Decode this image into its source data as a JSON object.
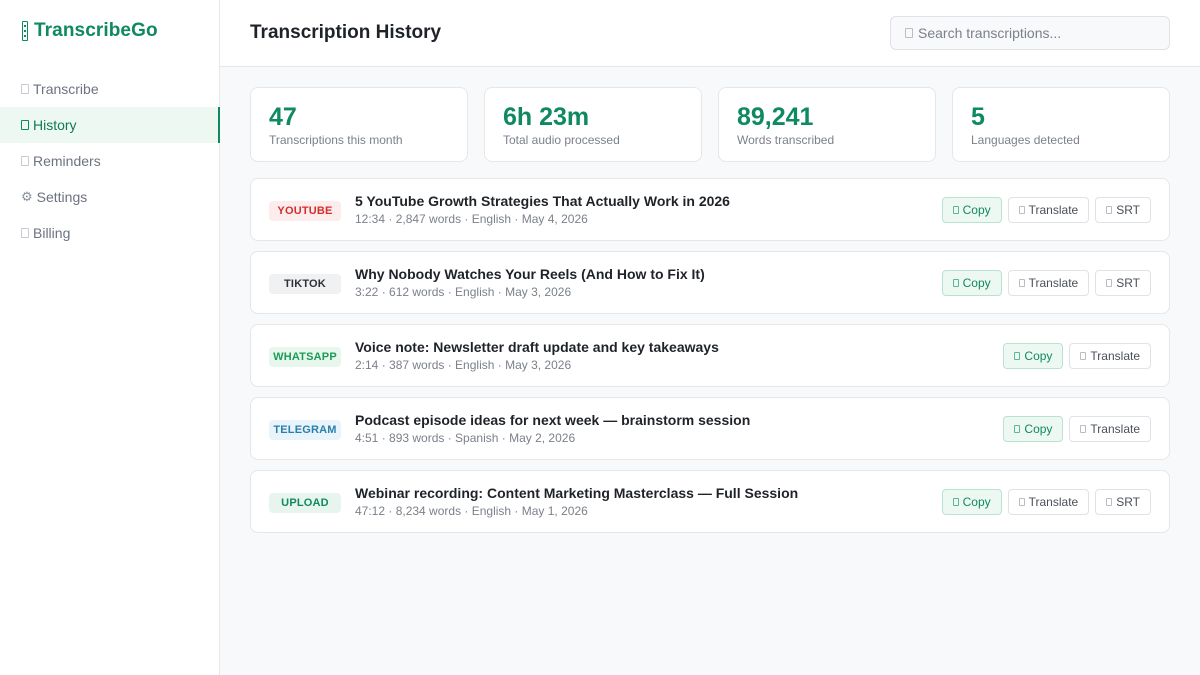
{
  "brand": {
    "name": "TranscribeGo",
    "color": "#0f8a5f"
  },
  "sidebar": {
    "items": [
      {
        "label": "Transcribe",
        "icon": "document-icon",
        "active": false
      },
      {
        "label": "History",
        "icon": "history-icon",
        "active": true
      },
      {
        "label": "Reminders",
        "icon": "reminder-icon",
        "active": false
      },
      {
        "label": "Settings",
        "icon": "gear-icon",
        "glyph": "⚙",
        "active": false
      },
      {
        "label": "Billing",
        "icon": "billing-icon",
        "active": false
      }
    ]
  },
  "header": {
    "title": "Transcription History",
    "search_placeholder": "Search transcriptions..."
  },
  "stats": [
    {
      "value": "47",
      "label": "Transcriptions this month"
    },
    {
      "value": "6h 23m",
      "label": "Total audio processed"
    },
    {
      "value": "89,241",
      "label": "Words transcribed"
    },
    {
      "value": "5",
      "label": "Languages detected"
    }
  ],
  "actions": {
    "copy": "Copy",
    "translate": "Translate",
    "srt": "SRT"
  },
  "transcriptions": [
    {
      "source": "YOUTUBE",
      "badge_class": "b-youtube",
      "title": "5 YouTube Growth Strategies That Actually Work in 2026",
      "meta": "12:34 · 2,847 words · English · May 4, 2026",
      "has_srt": true
    },
    {
      "source": "TIKTOK",
      "badge_class": "b-tiktok",
      "title": "Why Nobody Watches Your Reels (And How to Fix It)",
      "meta": "3:22 · 612 words · English · May 3, 2026",
      "has_srt": true
    },
    {
      "source": "WHATSAPP",
      "badge_class": "b-whatsapp",
      "title": "Voice note: Newsletter draft update and key takeaways",
      "meta": "2:14 · 387 words · English · May 3, 2026",
      "has_srt": false
    },
    {
      "source": "TELEGRAM",
      "badge_class": "b-telegram",
      "title": "Podcast episode ideas for next week — brainstorm session",
      "meta": "4:51 · 893 words · Spanish · May 2, 2026",
      "has_srt": false
    },
    {
      "source": "UPLOAD",
      "badge_class": "b-upload",
      "title": "Webinar recording: Content Marketing Masterclass — Full Session",
      "meta": "47:12 · 8,234 words · English · May 1, 2026",
      "has_srt": true
    }
  ]
}
